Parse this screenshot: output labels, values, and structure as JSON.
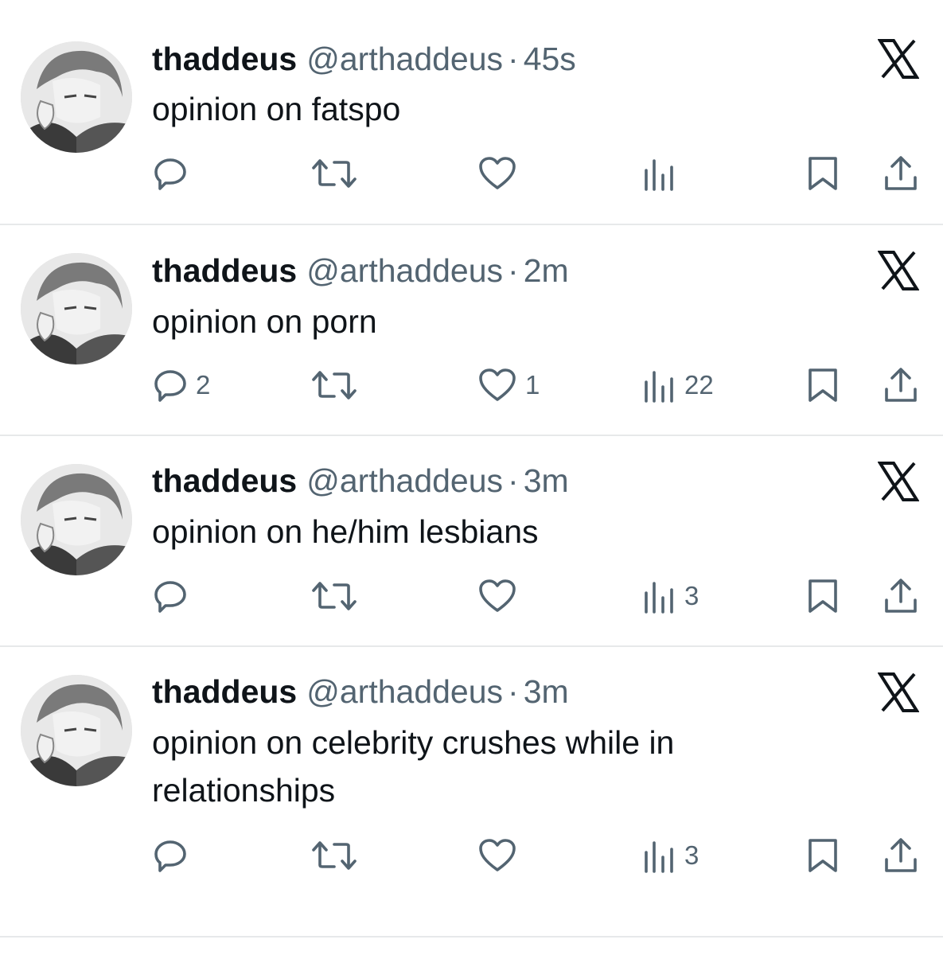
{
  "tweets": [
    {
      "name": "thaddeus",
      "handle": "@arthaddeus",
      "separator": "·",
      "time": "45s",
      "text": "opinion on fatspo",
      "replies": "",
      "retweets": "",
      "likes": "",
      "views": ""
    },
    {
      "name": "thaddeus",
      "handle": "@arthaddeus",
      "separator": "·",
      "time": "2m",
      "text": "opinion on porn",
      "replies": "2",
      "retweets": "",
      "likes": "1",
      "views": "22"
    },
    {
      "name": "thaddeus",
      "handle": "@arthaddeus",
      "separator": "·",
      "time": "3m",
      "text": "opinion on he/him lesbians",
      "replies": "",
      "retweets": "",
      "likes": "",
      "views": "3"
    },
    {
      "name": "thaddeus",
      "handle": "@arthaddeus",
      "separator": "·",
      "time": "3m",
      "text": "opinion on celebrity crushes while in relationships",
      "replies": "",
      "retweets": "",
      "likes": "",
      "views": "3"
    }
  ],
  "icons": {
    "reply": "reply-icon",
    "retweet": "retweet-icon",
    "like": "heart-icon",
    "views": "views-icon",
    "bookmark": "bookmark-icon",
    "share": "share-icon",
    "dismiss": "x-logo-icon"
  },
  "colors": {
    "text": "#0f1419",
    "muted": "#536471",
    "divider": "#e7e9ea",
    "background": "#ffffff"
  }
}
